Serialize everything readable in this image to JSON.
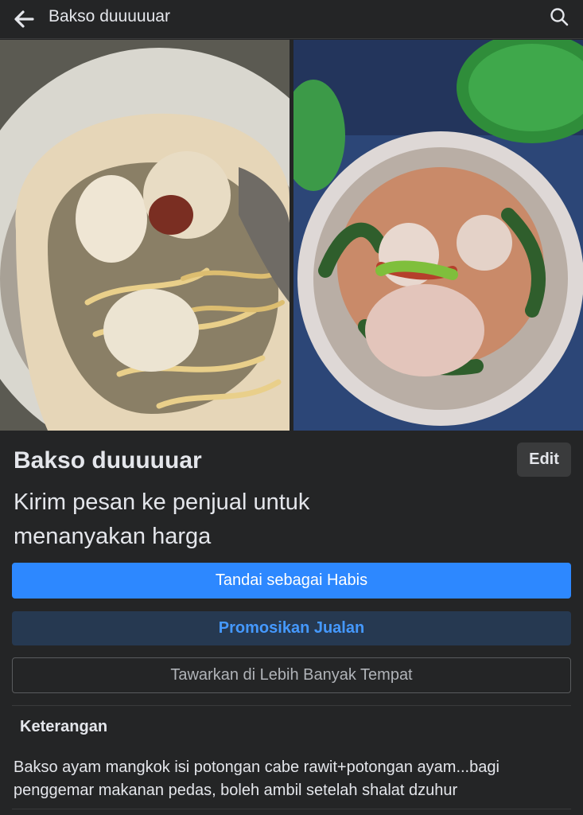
{
  "header": {
    "title": "Bakso duuuuuar",
    "back_icon": "arrow-left-icon",
    "search_icon": "search-icon"
  },
  "listing": {
    "title": "Bakso duuuuuar",
    "price_message": "Kirim pesan ke penjual untuk menanyakan harga",
    "edit_label": "Edit",
    "photos": [
      "meatball-with-noodles-photo",
      "meatball-bowl-photo"
    ]
  },
  "actions": {
    "mark_sold": "Tandai sebagai Habis",
    "promote": "Promosikan Jualan",
    "list_more": "Tawarkan di Lebih Banyak Tempat"
  },
  "description": {
    "heading": "Keterangan",
    "text": "Bakso ayam mangkok isi potongan cabe rawit+potongan ayam...bagi penggemar makanan pedas, boleh ambil setelah shalat dzuhur"
  },
  "colors": {
    "background": "#242526",
    "primary": "#2d88ff",
    "secondary_bg": "#263951",
    "secondary_text": "#4599ff"
  }
}
